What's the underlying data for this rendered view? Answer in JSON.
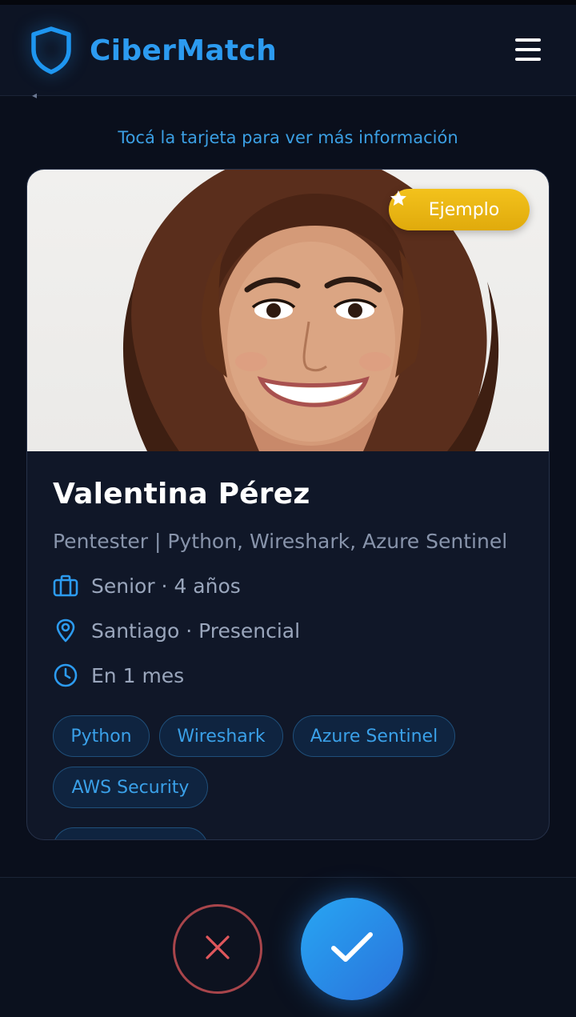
{
  "app": {
    "name": "CiberMatch",
    "accent_color": "#2c9bf0",
    "logo_icon": "shield-icon",
    "menu_icon": "hamburger-menu-icon"
  },
  "hint": "Tocá la tarjeta para ver más información",
  "card": {
    "badge": {
      "label": "Ejemplo",
      "icon": "star-icon",
      "color": "#f0bb17"
    },
    "photo": {
      "description_icon": "profile-photo"
    },
    "name": "Valentina Pérez",
    "title": "Pentester | Python, Wireshark, Azure Sentinel",
    "details": [
      {
        "icon": "briefcase-icon",
        "text": "Senior · 4 años"
      },
      {
        "icon": "location-pin-icon",
        "text": "Santiago · Presencial"
      },
      {
        "icon": "clock-icon",
        "text": "En 1 mes"
      }
    ],
    "skills": [
      "Python",
      "Wireshark",
      "Azure Sentinel",
      "AWS Security"
    ]
  },
  "actions": {
    "reject_icon": "close-icon",
    "reject_color": "#e0575c",
    "accept_icon": "check-icon",
    "accept_color": "#2a8de8"
  }
}
